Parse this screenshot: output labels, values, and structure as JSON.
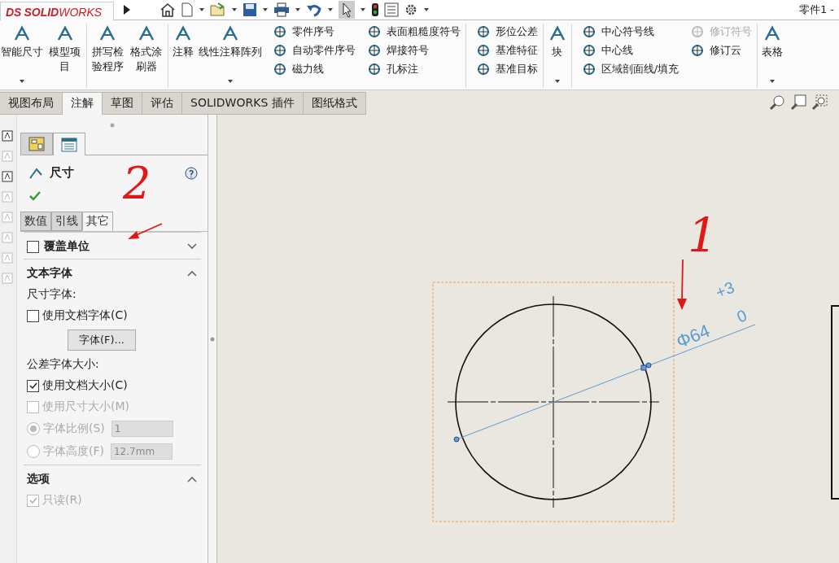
{
  "topbar": {
    "logo_mark": "DS",
    "logo": "**SOLID**WORKS",
    "title": "零件1 -"
  },
  "ribbon": {
    "groups": [
      {
        "tools": [
          {
            "kind": "large",
            "label": "智能尺寸",
            "dropdown": true
          },
          {
            "kind": "large",
            "label": "模型项目",
            "dropdown": false
          }
        ]
      },
      {
        "tools": [
          {
            "kind": "large",
            "label": "拼写检验程序",
            "dropdown": false
          },
          {
            "kind": "large",
            "label": "格式涂刷器",
            "dropdown": false
          }
        ]
      },
      {
        "tools": [
          {
            "kind": "large",
            "label": "注释",
            "dropdown": false
          },
          {
            "kind": "large",
            "label": "线性注释阵列",
            "dropdown": true
          },
          {
            "kind": "stack",
            "items": [
              {
                "label": "零件序号",
                "disabled": false
              },
              {
                "label": "自动零件序号",
                "disabled": false
              },
              {
                "label": "磁力线",
                "disabled": false
              }
            ]
          },
          {
            "kind": "stack",
            "items": [
              {
                "label": "表面粗糙度符号",
                "disabled": false
              },
              {
                "label": "焊接符号",
                "disabled": false
              },
              {
                "label": "孔标注",
                "disabled": false
              }
            ]
          }
        ]
      },
      {
        "tools": [
          {
            "kind": "stack",
            "items": [
              {
                "label": "形位公差",
                "disabled": false
              },
              {
                "label": "基准特征",
                "disabled": false
              },
              {
                "label": "基准目标",
                "disabled": false
              }
            ]
          }
        ]
      },
      {
        "tools": [
          {
            "kind": "large",
            "label": "块",
            "dropdown": true
          }
        ]
      },
      {
        "tools": [
          {
            "kind": "stack",
            "items": [
              {
                "label": "中心符号线",
                "disabled": false
              },
              {
                "label": "中心线",
                "disabled": false
              },
              {
                "label": "区域剖面线/填充",
                "disabled": false
              }
            ]
          },
          {
            "kind": "stack",
            "items": [
              {
                "label": "修订符号",
                "disabled": true
              },
              {
                "label": "修订云",
                "disabled": false
              }
            ]
          }
        ]
      },
      {
        "tools": [
          {
            "kind": "large",
            "label": "表格",
            "dropdown": true
          }
        ]
      }
    ]
  },
  "tabs": [
    {
      "label": "视图布局",
      "selected": false
    },
    {
      "label": "注解",
      "selected": true
    },
    {
      "label": "草图",
      "selected": false
    },
    {
      "label": "评估",
      "selected": false
    },
    {
      "label": "SOLIDWORKS 插件",
      "selected": false
    },
    {
      "label": "图纸格式",
      "selected": false
    }
  ],
  "panel": {
    "view_tabs": [
      {
        "selected": false
      },
      {
        "selected": true
      }
    ],
    "title": "尺寸",
    "annotation": "2",
    "tabs": [
      {
        "label": "数值",
        "selected": false
      },
      {
        "label": "引线",
        "selected": false
      },
      {
        "label": "其它",
        "selected": true
      }
    ],
    "sections": [
      {
        "kind": "checkbox-header",
        "label": "覆盖单位",
        "checked": false,
        "expanded": false
      },
      {
        "kind": "header",
        "label": "文本字体",
        "expanded": true,
        "rows": [
          {
            "kind": "label",
            "label": "尺寸字体:"
          },
          {
            "kind": "checkbox",
            "label": "使用文档字体(C)",
            "checked": false,
            "disabled": false
          },
          {
            "kind": "button",
            "label": "字体(F)..."
          },
          {
            "kind": "label",
            "label": "公差字体大小:"
          },
          {
            "kind": "checkbox",
            "label": "使用文档大小(C)",
            "checked": true,
            "disabled": false
          },
          {
            "kind": "checkbox",
            "label": "使用尺寸大小(M)",
            "checked": false,
            "disabled": true
          },
          {
            "kind": "radio",
            "label": "字体比例(S)",
            "selected": true,
            "disabled": true,
            "value": "1"
          },
          {
            "kind": "radio",
            "label": "字体高度(F)",
            "selected": false,
            "disabled": true,
            "value": "12.7mm"
          }
        ]
      },
      {
        "kind": "header",
        "label": "选项",
        "expanded": true,
        "rows": [
          {
            "kind": "checkbox",
            "label": "只读(R)",
            "checked": true,
            "disabled": true
          }
        ]
      }
    ]
  },
  "drawing": {
    "annotation": "1",
    "dimension": {
      "value": "Φ64",
      "upper": "+3",
      "lower": "0"
    }
  }
}
